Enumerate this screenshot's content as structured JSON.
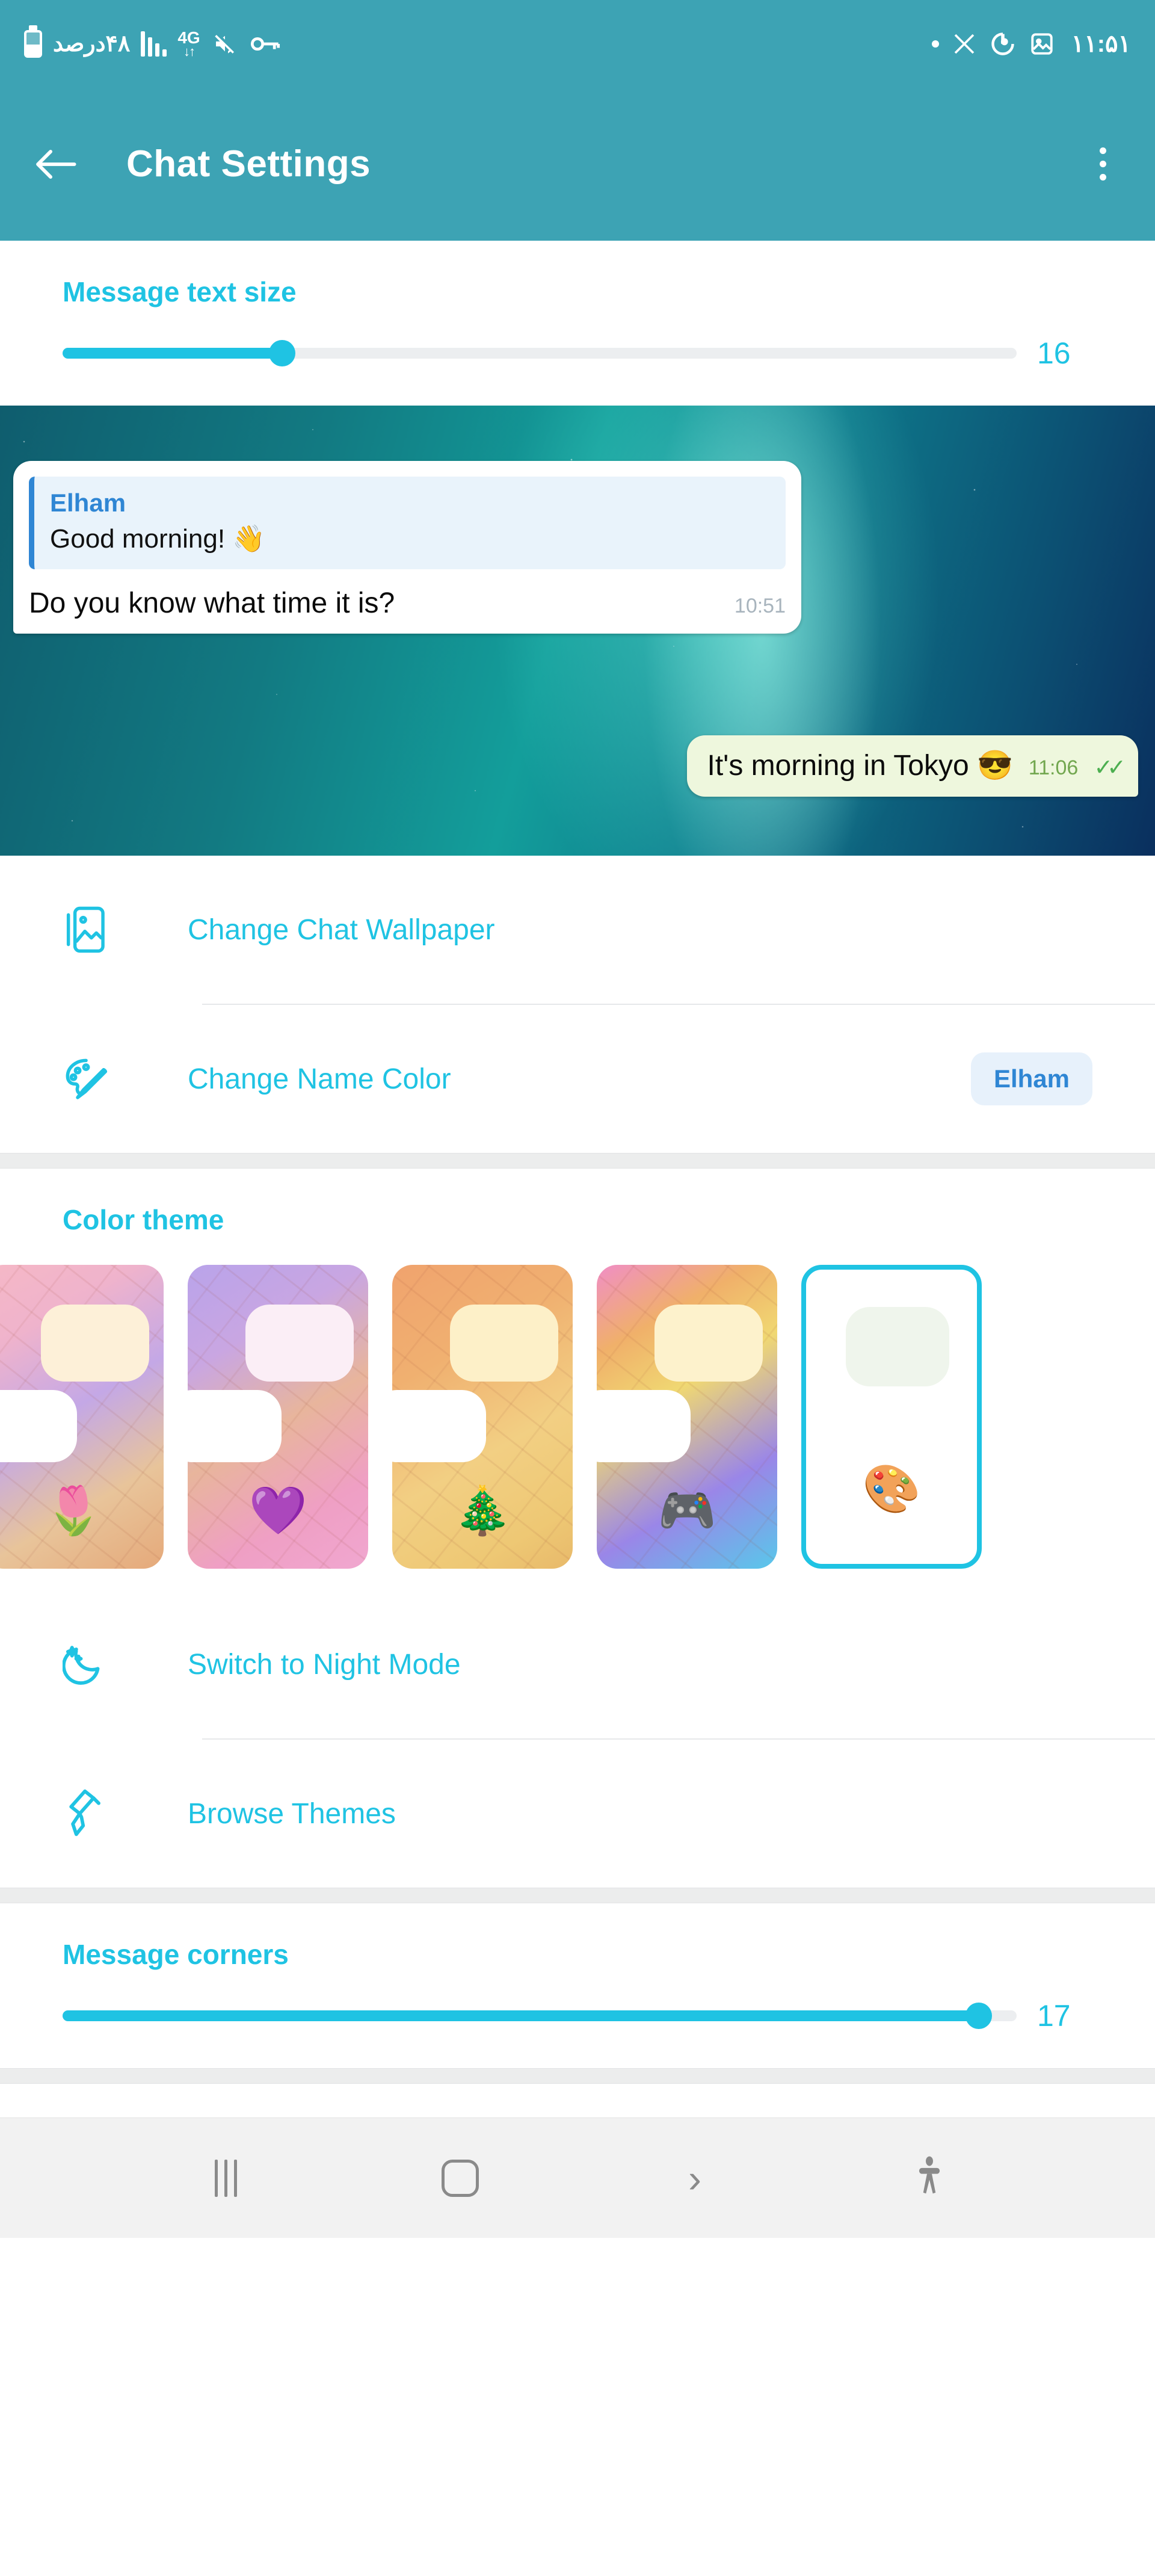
{
  "status_bar": {
    "battery_text": "۴۸درصد",
    "network_type": "4G",
    "time": "۱۱:۵۱",
    "icons": [
      "battery-icon",
      "signal-bars-icon",
      "data-transfer-icon",
      "mute-icon",
      "vpn-key-icon",
      "dot-indicator-icon",
      "x-app-icon",
      "power-saving-icon",
      "screenshot-icon"
    ]
  },
  "app_bar": {
    "title": "Chat Settings",
    "back_icon": "back-arrow-icon",
    "menu_icon": "overflow-menu-icon"
  },
  "message_text_size": {
    "title": "Message text size",
    "value": "16",
    "percent": 23
  },
  "chat_preview": {
    "incoming": {
      "quote_name": "Elham",
      "quote_text": "Good morning! 👋",
      "text": "Do you know what time it is?",
      "time": "10:51"
    },
    "outgoing": {
      "text": "It's morning in Tokyo 😎",
      "time": "11:06",
      "ticks": "✓✓"
    }
  },
  "wallpaper_section": {
    "rows": [
      {
        "label": "Change Chat Wallpaper",
        "icon": "image-wallpaper-icon",
        "badge": null
      },
      {
        "label": "Change Name Color",
        "icon": "palette-icon",
        "badge": "Elham"
      }
    ]
  },
  "color_theme": {
    "title": "Color theme",
    "cards": [
      {
        "emoji": "🌷",
        "name": "tulip-theme",
        "selected": false,
        "grad": "linear-gradient(150deg,#f6b8c6 0%,#efb3cc 22%,#c4a8e6 48%,#e8c49a 74%,#e5a97a 100%)",
        "bubble_top": "#fdf0d8"
      },
      {
        "emoji": "💜",
        "name": "purple-heart-theme",
        "selected": false,
        "grad": "linear-gradient(150deg,#b9a3ea 0%,#c9a6e2 26%,#e8b59c 52%,#ef9fc4 78%,#f0a7d0 100%)",
        "bubble_top": "#fbeef6"
      },
      {
        "emoji": "🎄",
        "name": "christmas-tree-theme",
        "selected": false,
        "grad": "linear-gradient(150deg,#f0a36e 0%,#f0b070 30%,#f2cf83 60%,#eec874 85%,#e8b96a 100%)",
        "bubble_top": "#fdf0c8"
      },
      {
        "emoji": "🎮",
        "name": "game-controller-theme",
        "selected": false,
        "grad": "linear-gradient(150deg,#f08ec6 0%,#f0b06a 22%,#f0d872 42%,#9a86e8 72%,#58c8ea 100%)",
        "bubble_top": "#fdf2cc"
      },
      {
        "emoji": "🎨",
        "name": "palette-theme",
        "selected": true,
        "grad": "#ffffff",
        "bubble_top": "#eff5ec"
      }
    ]
  },
  "theme_rows": [
    {
      "label": "Switch to Night Mode",
      "icon": "crescent-moon-icon"
    },
    {
      "label": "Browse Themes",
      "icon": "paint-roller-icon"
    }
  ],
  "message_corners": {
    "title": "Message corners",
    "value": "17",
    "percent": 96
  },
  "nav_bar": {
    "buttons": [
      {
        "name": "recents-button",
        "icon": "recents-icon"
      },
      {
        "name": "home-button",
        "icon": "home-icon"
      },
      {
        "name": "back-button",
        "icon": "chevron-right-icon"
      },
      {
        "name": "accessibility-button",
        "icon": "accessibility-icon"
      }
    ]
  },
  "colors": {
    "brand_teal": "#3da3b4",
    "accent_cyan": "#1fc3e3",
    "name_blue": "#2f86d4",
    "outgoing_bubble": "#eef7dd"
  }
}
